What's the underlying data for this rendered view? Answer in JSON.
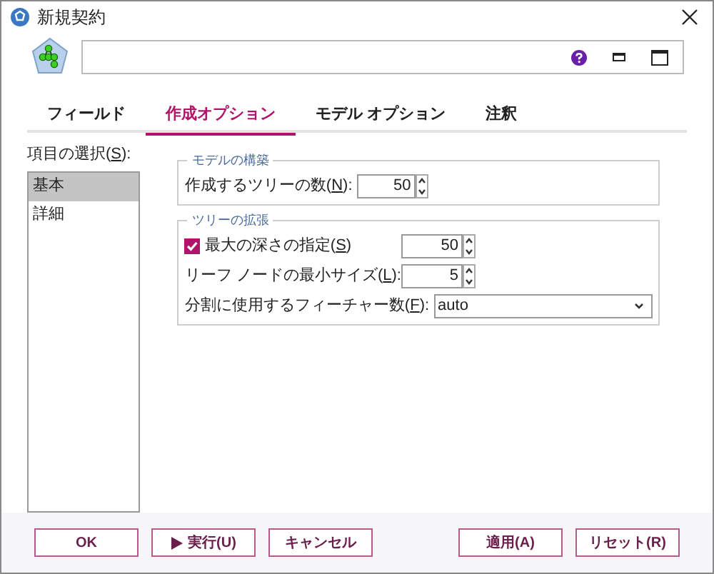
{
  "window": {
    "title": "新規契約"
  },
  "tabs": [
    {
      "label": "フィールド",
      "selected": false
    },
    {
      "label": "作成オプション",
      "selected": true
    },
    {
      "label": "モデル オプション",
      "selected": false
    },
    {
      "label": "注釈",
      "selected": false
    }
  ],
  "item_select": {
    "label": {
      "before": "項目の選択(",
      "key": "S",
      "after": "):"
    },
    "items": [
      {
        "label": "基本",
        "selected": true
      },
      {
        "label": "詳細",
        "selected": false
      }
    ]
  },
  "groups": [
    {
      "title": "モデルの構築",
      "rows": [
        {
          "kind": "spin",
          "label": {
            "before": "作成するツリーの数(",
            "key": "N",
            "after": "):"
          },
          "value": "50"
        }
      ]
    },
    {
      "title": "ツリーの拡張",
      "rows": [
        {
          "kind": "check-spin",
          "checked": true,
          "label": {
            "before": "最大の深さの指定(",
            "key": "S",
            "after": ")"
          },
          "value": "50"
        },
        {
          "kind": "spin",
          "label": {
            "before": "リーフ ノードの最小サイズ(",
            "key": "L",
            "after": "):"
          },
          "value": "5"
        },
        {
          "kind": "select",
          "label": {
            "before": "分割に使用するフィーチャー数(",
            "key": "F",
            "after": "):"
          },
          "value": "auto"
        }
      ]
    }
  ],
  "buttons_left": [
    {
      "label": "OK",
      "kind": "plain"
    },
    {
      "label": "実行(U)",
      "kind": "run"
    },
    {
      "label": "キャンセル",
      "kind": "plain"
    }
  ],
  "buttons_right": [
    {
      "label": "適用(A)",
      "kind": "plain"
    },
    {
      "label": "リセット(R)",
      "kind": "plain"
    }
  ]
}
